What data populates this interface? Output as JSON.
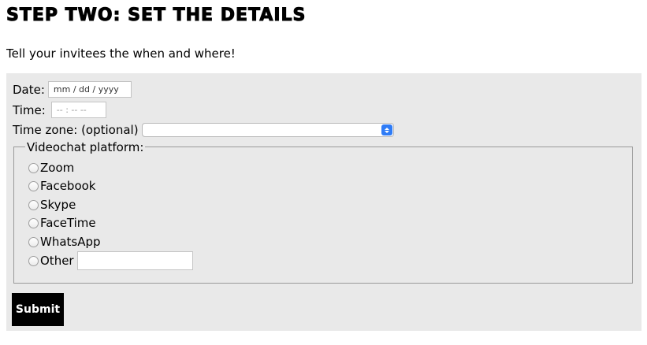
{
  "heading": "Step Two: Set the Details",
  "intro": "Tell your invitees the when and where!",
  "form": {
    "date": {
      "label": "Date:",
      "placeholder": "mm / dd / yyyy"
    },
    "time": {
      "label": "Time:",
      "placeholder": "-- : --   --"
    },
    "timezone": {
      "label": "Time zone: (optional)",
      "value": ""
    },
    "platform": {
      "legend": "Videochat platform:",
      "options": [
        "Zoom",
        "Facebook",
        "Skype",
        "FaceTime",
        "WhatsApp",
        "Other"
      ],
      "other_value": ""
    },
    "submit_label": "Submit"
  },
  "colors": {
    "panel_bg": "#e9e9e9",
    "select_accent": "#2f7cf6",
    "button_bg": "#000000",
    "button_text": "#ffffff"
  },
  "icons": {
    "select_arrow": "chevron-up-down-icon",
    "radio": "radio-unchecked-icon"
  }
}
